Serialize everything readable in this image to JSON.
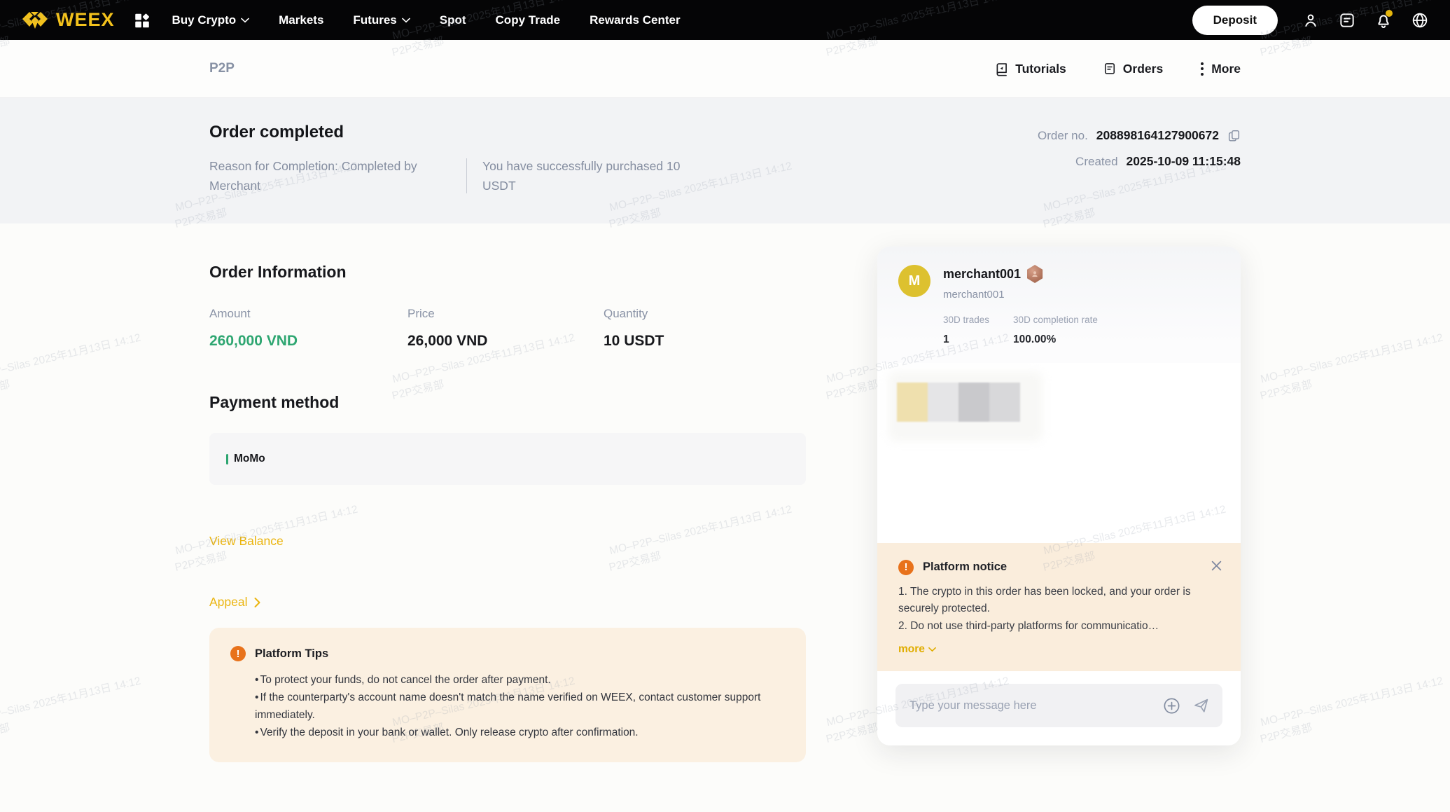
{
  "navbar": {
    "brand": "WEEX",
    "items": [
      {
        "label": "Buy Crypto",
        "caret": true
      },
      {
        "label": "Markets",
        "caret": false
      },
      {
        "label": "Futures",
        "caret": true
      },
      {
        "label": "Spot",
        "caret": false
      },
      {
        "label": "Copy Trade",
        "caret": false
      },
      {
        "label": "Rewards Center",
        "caret": false
      }
    ],
    "deposit_label": "Deposit"
  },
  "subnav": {
    "title": "P2P",
    "tutorials_label": "Tutorials",
    "orders_label": "Orders",
    "more_label": "More"
  },
  "banner": {
    "title": "Order completed",
    "reason": "Reason for Completion: Completed by Merchant",
    "success": "You have successfully purchased 10 USDT",
    "order_no_label": "Order no.",
    "order_no": "208898164127900672",
    "created_label": "Created",
    "created_value": "2025-10-09 11:15:48"
  },
  "order_info": {
    "title": "Order Information",
    "fields": [
      {
        "label": "Amount",
        "value": "260,000 VND"
      },
      {
        "label": "Price",
        "value": "26,000 VND"
      },
      {
        "label": "Quantity",
        "value": "10 USDT"
      }
    ]
  },
  "payment": {
    "title": "Payment method",
    "method": "MoMo"
  },
  "links": {
    "view_balance": "View Balance",
    "appeal": "Appeal"
  },
  "platform_tips": {
    "title": "Platform Tips",
    "tips": [
      "To protect your funds, do not cancel the order after payment.",
      "If the counterparty's account name doesn't match the name verified on WEEX, contact customer support immediately.",
      "Verify the deposit in your bank or wallet. Only release crypto after confirmation."
    ]
  },
  "chat": {
    "avatar_letter": "M",
    "merchant_name": "merchant001",
    "merchant_subname": "merchant001",
    "stats": [
      {
        "label": "30D trades",
        "value": "1"
      },
      {
        "label": "30D completion rate",
        "value": "100.00%"
      }
    ],
    "notice": {
      "title": "Platform notice",
      "line1": "1. The crypto in this order has been locked, and your order is securely protected.",
      "line2": "2. Do not use third-party platforms for communicatio…",
      "more_label": "more"
    },
    "input_placeholder": "Type your message here"
  },
  "watermark": {
    "line1": "MO–P2P–Silas 2025年11月13日 14:12",
    "line2": "P2P交易部"
  },
  "colors": {
    "brand_yellow": "#F3C21C",
    "link_yellow": "#EBB50F",
    "amount_green": "#2EA671",
    "notice_orange": "#E8721B",
    "tips_bg": "#FBF0E1",
    "notice_bg": "#FAEDDC",
    "navbar_bg": "#050506",
    "banner_bg": "#F2F3F5"
  }
}
